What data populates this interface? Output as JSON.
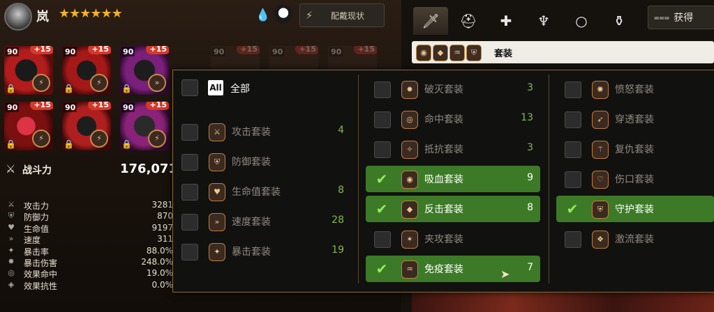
{
  "hero": {
    "name": "岚",
    "stars": "★★★★★★"
  },
  "header": {
    "equip_status_label": "配戴现状",
    "equip_status_icon": "⚡"
  },
  "equipment": [
    {
      "level": "90",
      "plus": "+15",
      "locked": true
    },
    {
      "level": "90",
      "plus": "+15",
      "locked": true
    },
    {
      "level": "90",
      "plus": "+15",
      "locked": true
    },
    {
      "level": "90",
      "plus": "+15",
      "locked": true
    },
    {
      "level": "90",
      "plus": "+15",
      "locked": true
    },
    {
      "level": "90",
      "plus": "+15",
      "locked": true
    }
  ],
  "background_slots": [
    {
      "level": "90",
      "plus": "+15"
    },
    {
      "level": "90",
      "plus": "+15"
    },
    {
      "level": "90",
      "plus": "+15"
    }
  ],
  "power": {
    "label": "战斗力",
    "value": "176,071"
  },
  "stats": [
    {
      "icon": "⚔",
      "label": "攻击力",
      "value": "3281"
    },
    {
      "icon": "⛨",
      "label": "防御力",
      "value": "870"
    },
    {
      "icon": "♥",
      "label": "生命值",
      "value": "9197"
    },
    {
      "icon": "»",
      "label": "速度",
      "value": "311"
    },
    {
      "icon": "✦",
      "label": "暴击率",
      "value": "88.0%"
    },
    {
      "icon": "✸",
      "label": "暴击伤害",
      "value": "248.0%"
    },
    {
      "icon": "◎",
      "label": "效果命中",
      "value": "19.0%"
    },
    {
      "icon": "◈",
      "label": "效果抗性",
      "value": "0.0%"
    }
  ],
  "tabs": [
    {
      "icon": "🗡",
      "name": "weapon"
    },
    {
      "icon": "⛑",
      "name": "helmet"
    },
    {
      "icon": "✚",
      "name": "armor"
    },
    {
      "icon": "♆",
      "name": "necklace"
    },
    {
      "icon": "○",
      "name": "ring"
    },
    {
      "icon": "⚱",
      "name": "boots"
    }
  ],
  "sort": {
    "label": "获得",
    "icon": "⩶"
  },
  "selected_filter": {
    "label": "套装",
    "chips": [
      "◉",
      "◆",
      "♒",
      "⛨"
    ]
  },
  "filter": {
    "all_label": "全部",
    "all_icon": "All",
    "col1": [
      {
        "label": "攻击套装",
        "count": "4",
        "checked": false,
        "icon": "⚔"
      },
      {
        "label": "防御套装",
        "count": "",
        "checked": false,
        "icon": "⛨"
      },
      {
        "label": "生命值套装",
        "count": "8",
        "checked": false,
        "icon": "♥"
      },
      {
        "label": "速度套装",
        "count": "28",
        "checked": false,
        "icon": "»"
      },
      {
        "label": "暴击套装",
        "count": "19",
        "checked": false,
        "icon": "✦"
      }
    ],
    "col2": [
      {
        "label": "破灭套装",
        "count": "3",
        "checked": false,
        "icon": "✹"
      },
      {
        "label": "命中套装",
        "count": "13",
        "checked": false,
        "icon": "◎"
      },
      {
        "label": "抵抗套装",
        "count": "3",
        "checked": false,
        "icon": "✧"
      },
      {
        "label": "吸血套装",
        "count": "9",
        "checked": true,
        "icon": "◉"
      },
      {
        "label": "反击套装",
        "count": "8",
        "checked": true,
        "icon": "◆"
      },
      {
        "label": "夹攻套装",
        "count": "",
        "checked": false,
        "icon": "✶"
      },
      {
        "label": "免疫套装",
        "count": "7",
        "checked": true,
        "icon": "♒"
      }
    ],
    "col3": [
      {
        "label": "愤怒套装",
        "count": "",
        "checked": false,
        "icon": "✺"
      },
      {
        "label": "穿透套装",
        "count": "",
        "checked": false,
        "icon": "➶"
      },
      {
        "label": "复仇套装",
        "count": "",
        "checked": false,
        "icon": "⚚"
      },
      {
        "label": "伤口套装",
        "count": "",
        "checked": false,
        "icon": "♡"
      },
      {
        "label": "守护套装",
        "count": "",
        "checked": true,
        "icon": "⛨"
      },
      {
        "label": "激流套装",
        "count": "",
        "checked": false,
        "icon": "❖"
      }
    ]
  },
  "colors": {
    "accent_gold": "#c98a4a",
    "checked_green": "#3d7a27",
    "count_green": "#88b84a",
    "plus_red": "#d13a2a"
  }
}
